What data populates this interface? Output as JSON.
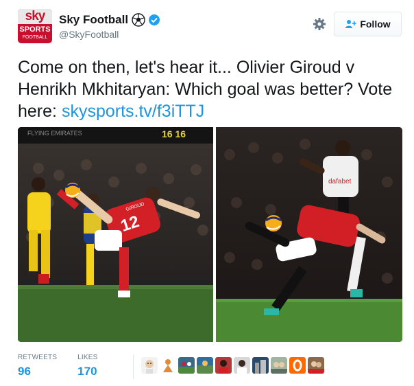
{
  "account": {
    "display_name": "Sky Football",
    "handle": "@SkyFootball",
    "avatar_text_top": "sky",
    "avatar_text_mid": "SPORTS",
    "avatar_text_bottom": "FOOTBALL",
    "verified": true
  },
  "follow_button": {
    "label": "Follow"
  },
  "tweet": {
    "text": "Come on then, let's hear it... Olivier Giroud v Henrikh Mkhitaryan: Which goal was better? Vote here: ",
    "link": "skysports.tv/f3iTTJ"
  },
  "media": {
    "photos": [
      {
        "subject": "Giroud scorpion kick goal",
        "jersey_number": "12",
        "jersey_name": "GIROUD",
        "scoreboard": "16 16"
      },
      {
        "subject": "Mkhitaryan scorpion kick goal",
        "shirt_sponsor": "dafabet"
      }
    ]
  },
  "stats": {
    "retweets_label": "RETWEETS",
    "retweets": "96",
    "likes_label": "LIKES",
    "likes": "170"
  },
  "likers": [
    {
      "icon": "avatar-face",
      "color": "#f2f2f2"
    },
    {
      "icon": "avatar-figure-orange",
      "color": "#ffffff"
    },
    {
      "icon": "avatar-crowd",
      "color": "#3a6a8a"
    },
    {
      "icon": "avatar-photo",
      "color": "#2f6fa0"
    },
    {
      "icon": "avatar-red",
      "color": "#b33a3a"
    },
    {
      "icon": "avatar-person",
      "color": "#d8d8d8"
    },
    {
      "icon": "avatar-building",
      "color": "#2a4a6a"
    },
    {
      "icon": "avatar-people",
      "color": "#a0b5a0"
    },
    {
      "icon": "avatar-orange-o",
      "color": "#ff6a00"
    },
    {
      "icon": "avatar-group",
      "color": "#8a6a4a"
    }
  ],
  "colors": {
    "link": "#1b95e0",
    "text": "#14171a",
    "secondary": "#657786",
    "sky_red": "#c8102e",
    "verified": "#1da1f2"
  }
}
